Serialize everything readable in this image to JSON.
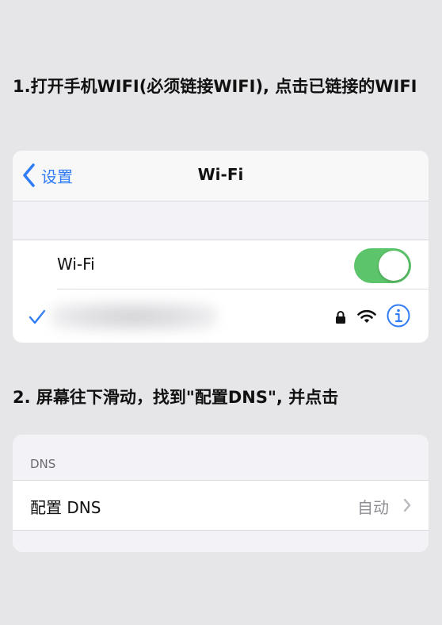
{
  "step1": {
    "text": "1.打开手机WIFI(必须链接WIFI), 点击已链接的WIFI"
  },
  "wifi_screen": {
    "back_label": "设置",
    "title": "Wi-Fi",
    "wifi_label": "Wi-Fi",
    "wifi_toggle_on": true,
    "connected_network_name": ""
  },
  "step2": {
    "text": "2. 屏幕往下滑动，找到\"配置DNS\", 并点击"
  },
  "dns_screen": {
    "section_header": "DNS",
    "row_label": "配置 DNS",
    "row_value": "自动"
  },
  "colors": {
    "accent": "#2f7cf6",
    "toggle_on": "#5cc46a",
    "background": "#e6e6e9"
  },
  "icons": [
    "chevron-left-icon",
    "checkmark-icon",
    "lock-icon",
    "wifi-icon",
    "info-icon",
    "chevron-right-icon"
  ]
}
